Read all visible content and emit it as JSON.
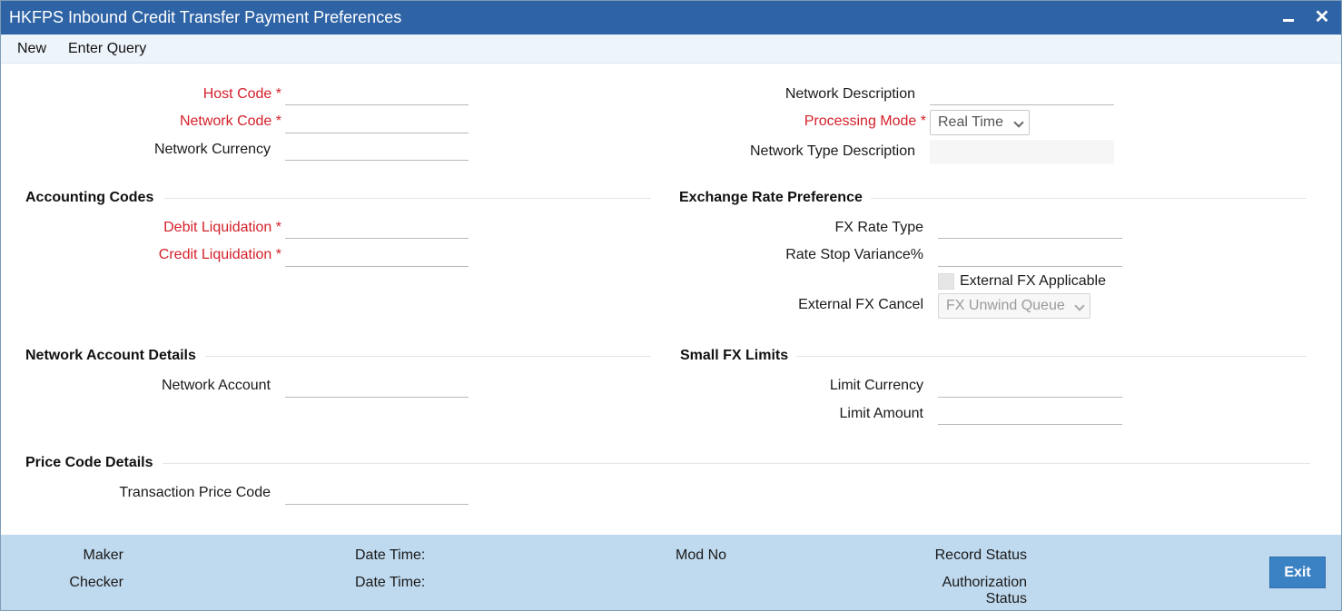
{
  "window": {
    "title": "HKFPS Inbound Credit Transfer Payment Preferences",
    "minimize": "–",
    "close": "✕"
  },
  "menu": {
    "new": "New",
    "enter_query": "Enter Query"
  },
  "fields": {
    "host_code": {
      "label": "Host Code",
      "value": ""
    },
    "network_code": {
      "label": "Network Code",
      "value": ""
    },
    "network_currency": {
      "label": "Network Currency",
      "value": ""
    },
    "network_description": {
      "label": "Network Description",
      "value": ""
    },
    "processing_mode": {
      "label": "Processing Mode",
      "value": "Real Time"
    },
    "network_type_description": {
      "label": "Network Type Description",
      "value": ""
    }
  },
  "accounting_codes": {
    "title": "Accounting Codes",
    "debit_liquidation": {
      "label": "Debit Liquidation",
      "value": ""
    },
    "credit_liquidation": {
      "label": "Credit Liquidation",
      "value": ""
    }
  },
  "exchange_rate": {
    "title": "Exchange Rate Preference",
    "fx_rate_type": {
      "label": "FX Rate Type",
      "value": ""
    },
    "rate_stop_variance": {
      "label": "Rate Stop Variance%",
      "value": ""
    },
    "external_fx_applicable": {
      "label": "External FX Applicable",
      "checked": false
    },
    "external_fx_cancel": {
      "label": "External FX Cancel",
      "value": "FX Unwind Queue"
    }
  },
  "network_account": {
    "title": "Network Account Details",
    "network_account": {
      "label": "Network Account",
      "value": ""
    }
  },
  "small_fx": {
    "title": "Small FX Limits",
    "limit_currency": {
      "label": "Limit Currency",
      "value": ""
    },
    "limit_amount": {
      "label": "Limit Amount",
      "value": ""
    }
  },
  "price_code": {
    "title": "Price Code Details",
    "transaction_price_code": {
      "label": "Transaction Price Code",
      "value": ""
    }
  },
  "required_marker": "*",
  "footer": {
    "maker": "Maker",
    "checker": "Checker",
    "date_time_1": "Date Time:",
    "date_time_2": "Date Time:",
    "mod_no": "Mod No",
    "record_status": "Record Status",
    "authorization_status_line1": "Authorization",
    "authorization_status_line2": "Status",
    "exit": "Exit"
  },
  "colors": {
    "titlebar": "#2e63a5",
    "required": "#d4202a",
    "footer": "#bfd9ee",
    "exit_button": "#3b82c4"
  }
}
